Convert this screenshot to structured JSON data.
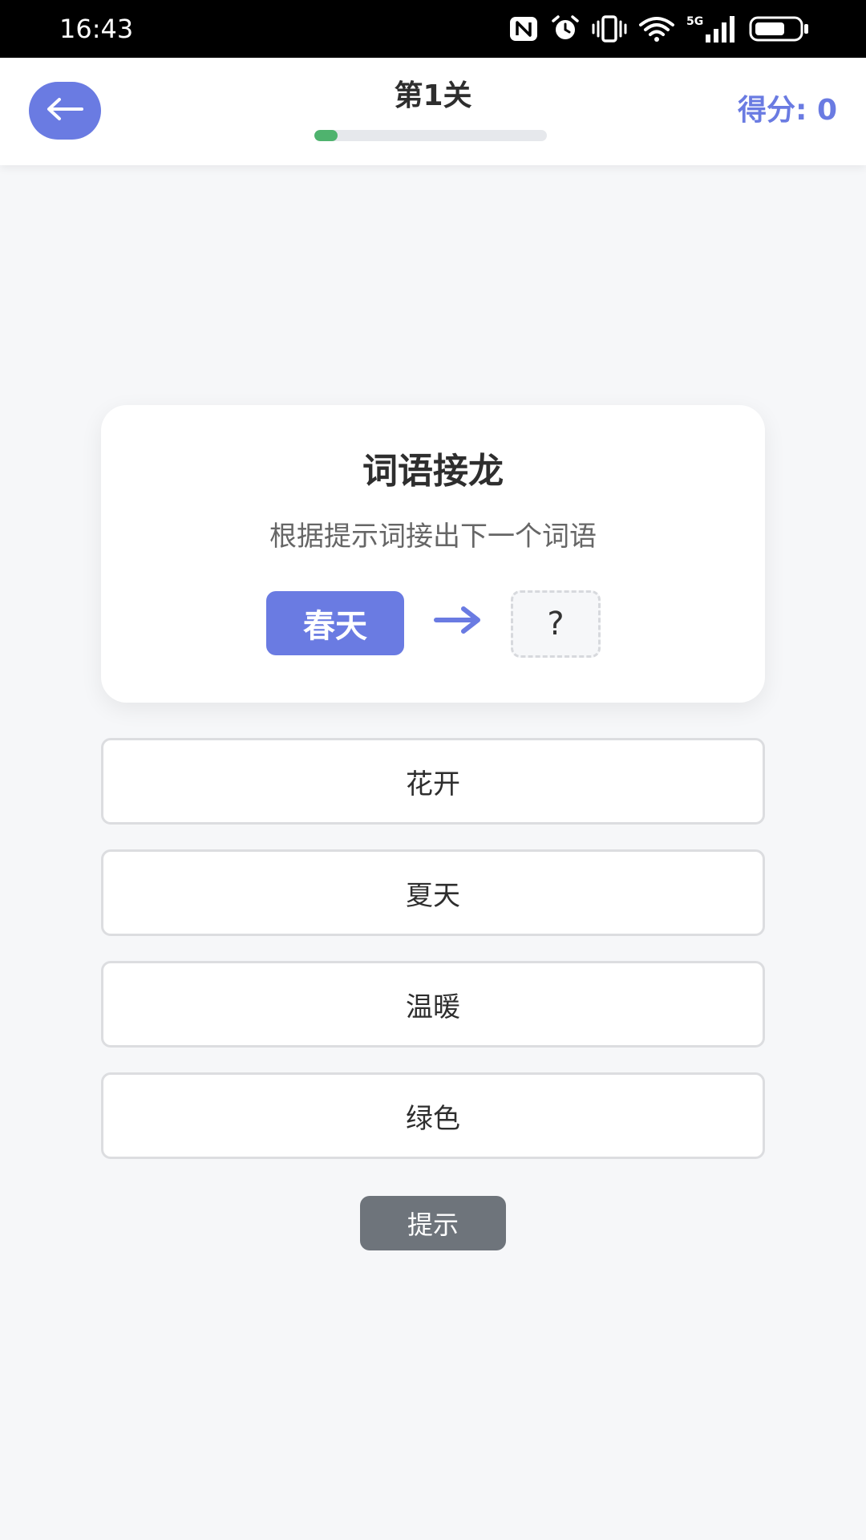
{
  "status_bar": {
    "time": "16:43",
    "icons": [
      "nfc-icon",
      "alarm-icon",
      "vibrate-icon",
      "wifi-icon",
      "signal-5g-icon",
      "battery-icon"
    ]
  },
  "header": {
    "back_icon": "arrow-left-icon",
    "level_title": "第1关",
    "progress_fraction": 0.1,
    "score_label": "得分: 0"
  },
  "puzzle": {
    "title": "词语接龙",
    "subtitle": "根据提示词接出下一个词语",
    "given_word": "春天",
    "answer_placeholder": "?"
  },
  "options": [
    "花开",
    "夏天",
    "温暖",
    "绿色"
  ],
  "hint_button": "提示",
  "colors": {
    "accent": "#6a7be2",
    "progress": "#4fb36e",
    "hint_button": "#6e747b",
    "background": "#f6f7f9"
  }
}
